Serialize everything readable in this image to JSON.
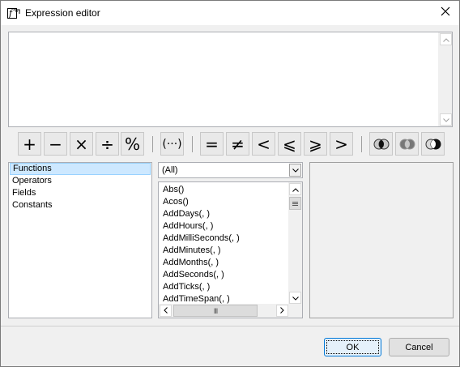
{
  "window": {
    "title": "Expression editor",
    "icon": "function-icon",
    "close_icon": "close-icon"
  },
  "editor": {
    "value": ""
  },
  "toolbar": {
    "arithmetic": [
      {
        "name": "plus",
        "symbol": "+"
      },
      {
        "name": "minus",
        "symbol": "−"
      },
      {
        "name": "multiply",
        "symbol": "×"
      },
      {
        "name": "divide",
        "symbol": "÷"
      },
      {
        "name": "modulo",
        "symbol": "%"
      }
    ],
    "group": {
      "name": "parentheses",
      "symbol": "(···)"
    },
    "comparison": [
      {
        "name": "equals",
        "symbol": "="
      },
      {
        "name": "not-equals",
        "symbol": "≠"
      },
      {
        "name": "less-than",
        "symbol": "<"
      },
      {
        "name": "less-or-equal",
        "symbol": "⩽"
      },
      {
        "name": "greater-or-equal",
        "symbol": "⩾"
      },
      {
        "name": "greater-than",
        "symbol": ">"
      }
    ],
    "logical_icons": [
      "and-icon",
      "or-icon",
      "not-icon"
    ]
  },
  "categories": {
    "items": [
      "Functions",
      "Operators",
      "Fields",
      "Constants"
    ],
    "selected": "Functions"
  },
  "filter": {
    "selected": "(All)"
  },
  "functions": {
    "items": [
      "Abs()",
      "Acos()",
      "AddDays(, )",
      "AddHours(, )",
      "AddMilliSeconds(, )",
      "AddMinutes(, )",
      "AddMonths(, )",
      "AddSeconds(, )",
      "AddTicks(, )",
      "AddTimeSpan(, )"
    ],
    "hthumb_grip": "III"
  },
  "buttons": {
    "ok": "OK",
    "cancel": "Cancel"
  },
  "colors": {
    "selection_bg": "#cde8ff",
    "selection_border": "#99d1ff",
    "default_button_border": "#0078d7",
    "window_bg": "#f0f0f0"
  }
}
